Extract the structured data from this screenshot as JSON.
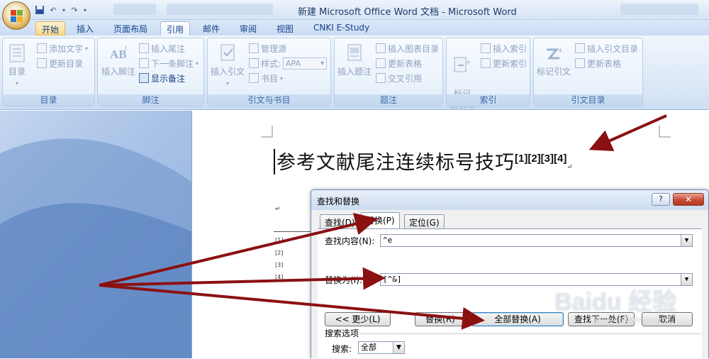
{
  "window": {
    "title": "新建 Microsoft Office Word 文档 - Microsoft Word"
  },
  "tabs": [
    "开始",
    "插入",
    "页面布局",
    "引用",
    "邮件",
    "审阅",
    "视图",
    "CNKI E-Study"
  ],
  "active_tab": "引用",
  "ribbon": {
    "toc": {
      "big_button": "目录",
      "add_text": "添加文字",
      "update_toc": "更新目录",
      "label": "目录"
    },
    "footnote": {
      "insert_footnote": "插入脚注",
      "insert_endnote": "插入尾注",
      "next_footnote": "下一条脚注",
      "show_notes": "显示备注",
      "label": "脚注"
    },
    "citation": {
      "insert_citation": "插入引文",
      "manage_sources": "管理源",
      "style_label": "样式:",
      "style_value": "APA",
      "bibliography": "书目",
      "label": "引文与书目"
    },
    "caption": {
      "insert_caption": "插入题注",
      "insert_table_of_figures": "插入图表目录",
      "update_table": "更新表格",
      "cross_reference": "交叉引用",
      "label": "题注"
    },
    "index": {
      "mark_entry": "标记\n索引项",
      "insert_index": "插入索引",
      "update_index": "更新索引",
      "label": "索引"
    },
    "toa": {
      "mark_citation": "标记引文",
      "insert_toa": "插入引文目录",
      "update_table": "更新表格",
      "label": "引文目录"
    }
  },
  "document": {
    "title": "参考文献尾注连续标号技巧",
    "superscript": "[1][2][3][4]",
    "endnotes": [
      "[1]",
      "[2]",
      "[3]",
      "[4]"
    ],
    "para_mark": "↵"
  },
  "dialog": {
    "title": "查找和替换",
    "help": "?",
    "close": "✕",
    "tabs": [
      "查找(D)",
      "替换(P)",
      "定位(G)"
    ],
    "active_tab": "替换(P)",
    "find_label": "查找内容(N):",
    "find_value": "^e",
    "replace_label": "替换为(I):",
    "replace_value": "[^&]",
    "buttons": {
      "less": "<< 更少(L)",
      "replace": "替换(R)",
      "replace_all": "全部替换(A)",
      "find_next": "查找下一处(F)",
      "cancel": "取消"
    },
    "search_options": "搜索选项",
    "search_label": "搜索:",
    "search_value": "全部"
  },
  "watermark": {
    "main": "Baidu 经验",
    "sub": "jingyan.baidu.com"
  },
  "colors": {
    "arrow": "#8b1010",
    "ribbon_text": "#15428b",
    "disabled_text": "#8fa3bf"
  }
}
